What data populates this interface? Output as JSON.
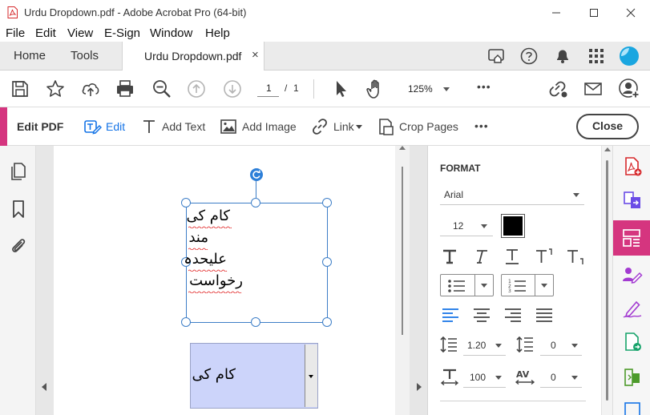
{
  "window": {
    "title": "Urdu Dropdown.pdf - Adobe Acrobat Pro (64-bit)"
  },
  "menu": [
    "File",
    "Edit",
    "View",
    "E-Sign",
    "Window",
    "Help"
  ],
  "tabs": {
    "home": "Home",
    "tools": "Tools",
    "document": "Urdu Dropdown.pdf",
    "close_glyph": "×"
  },
  "toolbar": {
    "page_current": "1",
    "page_separator": "/",
    "page_total": "1",
    "zoom": "125%",
    "more": "•••"
  },
  "editbar": {
    "title": "Edit PDF",
    "edit": "Edit",
    "add_text": "Add Text",
    "add_image": "Add Image",
    "link": "Link",
    "crop_pages": "Crop Pages",
    "more": "•••",
    "close": "Close"
  },
  "document": {
    "textbox_lines": [
      "کام کی",
      "مند",
      "علیحدہ",
      "رخواست"
    ],
    "dropdown_value": "کام کی"
  },
  "format": {
    "heading": "FORMAT",
    "font": "Arial",
    "font_size": "12",
    "color": "#000000",
    "line_spacing": "1.20",
    "paragraph_spacing": "0",
    "horizontal_scale": "100",
    "char_spacing": "0"
  },
  "colors": {
    "accent": "#d5357f",
    "selection": "#3d7ec7",
    "link_blue": "#1473e6",
    "dropdown_fill": "#ccd4fa"
  }
}
